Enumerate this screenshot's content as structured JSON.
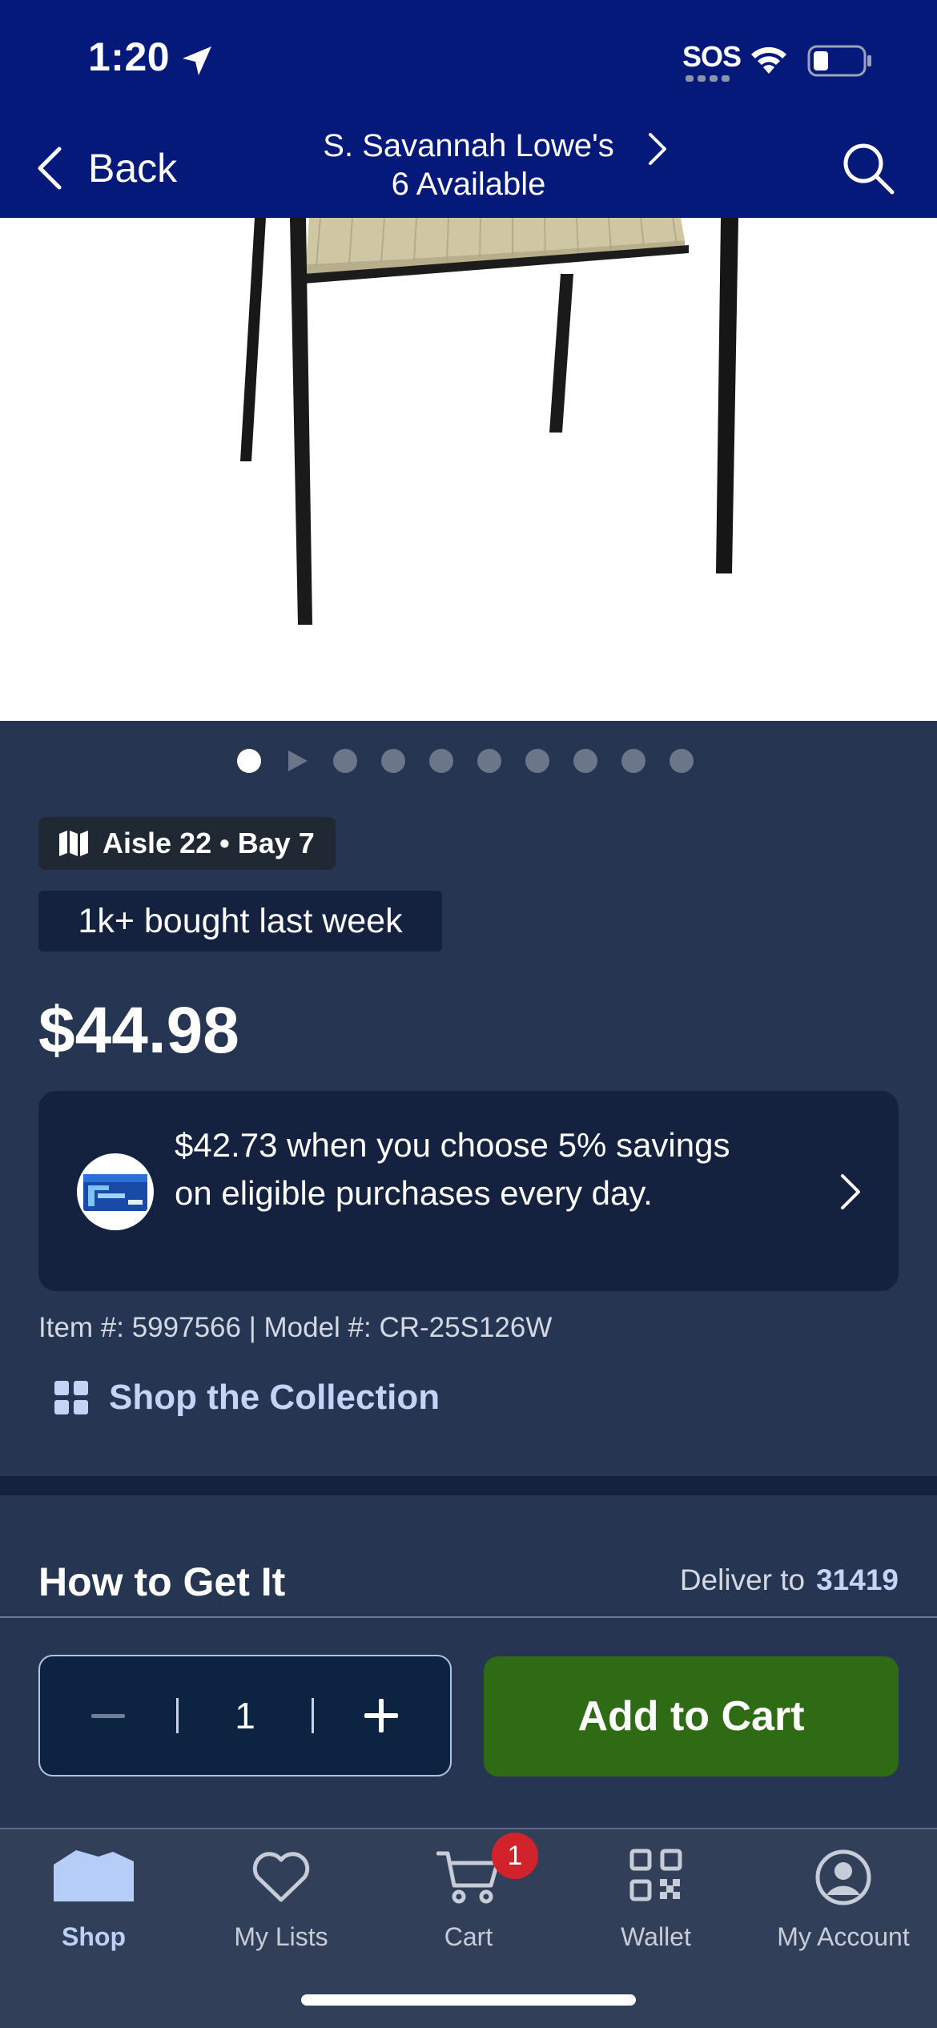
{
  "status_bar": {
    "time": "1:20",
    "carrier_text": "SOS"
  },
  "header": {
    "back_label": "Back",
    "store_name": "S. Savannah Lowe's",
    "availability": "6 Available"
  },
  "carousel": {
    "count": 10,
    "active_index": 0
  },
  "product": {
    "location_badge": "Aisle 22 • Bay 7",
    "social_proof": "1k+ bought last week",
    "price": "$44.98",
    "savings_offer": "$42.73 when you choose 5% savings on eligible purchases every day.",
    "item_model": "Item #: 5997566 | Model #: CR-25S126W",
    "collection_link": "Shop the Collection"
  },
  "fulfillment": {
    "title": "How to Get It",
    "deliver_label": "Deliver to",
    "zip": "31419"
  },
  "actions": {
    "quantity": "1",
    "add_to_cart_label": "Add to Cart"
  },
  "tab_bar": {
    "items": [
      {
        "label": "Shop",
        "icon": "home-icon",
        "active": true
      },
      {
        "label": "My Lists",
        "icon": "heart-icon",
        "active": false
      },
      {
        "label": "Cart",
        "icon": "cart-icon",
        "active": false
      },
      {
        "label": "Wallet",
        "icon": "qr-code-icon",
        "active": false
      },
      {
        "label": "My Account",
        "icon": "account-icon",
        "active": false
      }
    ],
    "cart_badge": "1"
  },
  "colors": {
    "header_bg": "#04197a",
    "page_bg": "#263652",
    "card_bg": "#14213f",
    "add_to_cart_bg": "#2f6a14",
    "link": "#c4d3f6",
    "badge_red": "#d2222c"
  }
}
